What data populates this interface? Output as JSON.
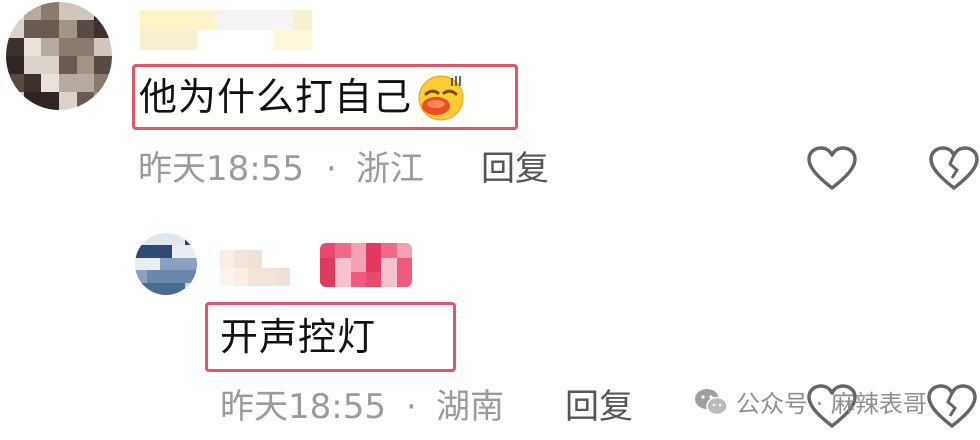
{
  "comments": [
    {
      "text": "他为什么打自己",
      "emoji": "sweating-face-emoji",
      "time": "昨天18:55",
      "separator": "·",
      "location": "浙江",
      "reply_label": "回复"
    },
    {
      "text": "开声控灯",
      "time": "昨天18:55",
      "separator": "·",
      "location": "湖南",
      "reply_label": "回复"
    }
  ],
  "icons": {
    "like": "heart-outline-icon",
    "dislike": "broken-heart-icon"
  },
  "watermark": {
    "text": "公众号 · 麻辣表哥",
    "logo": "wechat-logo-icon"
  },
  "colors": {
    "highlight_border": "#e0566a",
    "meta_text": "#9b9b9b",
    "reply_text": "#555555",
    "comment_text": "#111111"
  }
}
